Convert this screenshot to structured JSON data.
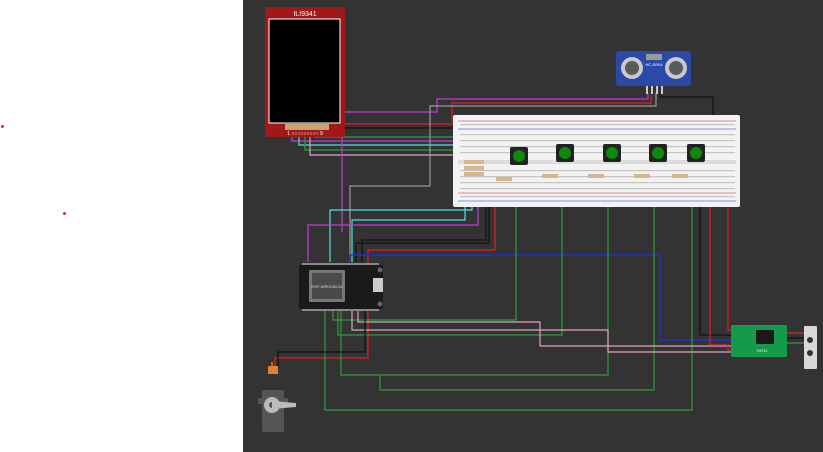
{
  "tft_display": {
    "label": "ILI9341",
    "pins": "1 ○○○○○○○○○ 9"
  },
  "ultrasonic": {
    "label": "HC-SR04"
  },
  "esp32": {
    "label": "ESP-WROOM-32"
  },
  "hx711": {
    "label": "HX711"
  },
  "colors": {
    "canvas": "#333333",
    "wire_red": "#e02020",
    "wire_black": "#111111",
    "wire_green": "#2e9c3a",
    "wire_blue": "#1b32e0",
    "wire_cyan": "#4fe0e0",
    "wire_purple": "#c23bd4",
    "wire_pink": "#e0a0c8",
    "wire_grey": "#9a9a9a",
    "button_green": "#0c8a0c",
    "breadboard": "#f2f2f2"
  }
}
